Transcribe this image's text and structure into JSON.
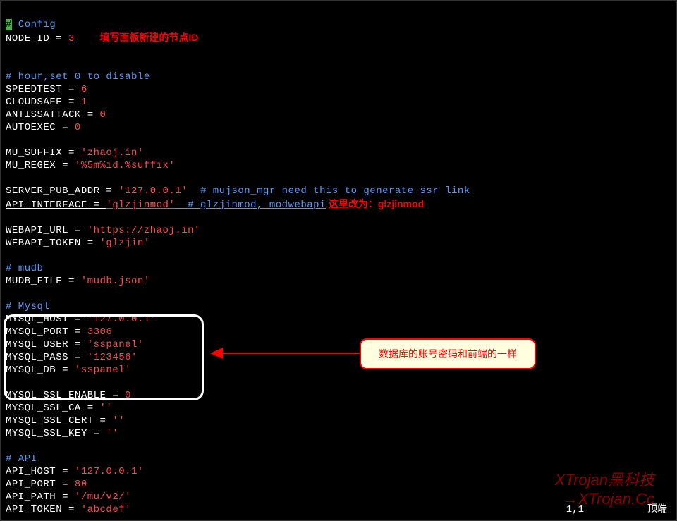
{
  "title_hash": "#",
  "title_word": " Config",
  "node_id_key": "NODE_ID = ",
  "node_id_val": "3",
  "annot_node": "填写面板新建的节点ID",
  "comment_hour": "# hour,set 0 to disable",
  "speedtest_k": "SPEEDTEST = ",
  "speedtest_v": "6",
  "cloudsafe_k": "CLOUDSAFE = ",
  "cloudsafe_v": "1",
  "antiss_k": "ANTISSATTACK = ",
  "antiss_v": "0",
  "autoexec_k": "AUTOEXEC = ",
  "autoexec_v": "0",
  "musuffix_k": "MU_SUFFIX = ",
  "musuffix_v": "'zhaoj.in'",
  "muregex_k": "MU_REGEX = ",
  "muregex_v": "'%5m%id.%suffix'",
  "serverpub_k": "SERVER_PUB_ADDR = ",
  "serverpub_v": "'127.0.0.1'",
  "serverpub_c": "  # mujson_mgr need this to generate ssr link",
  "apiint_k": "API_INTERFACE = ",
  "apiint_v": "'glzjinmod'",
  "apiint_c": "  # glzjinmod, modwebapi",
  "annot_api_prefix": " 这里改为：",
  "annot_api_bold": "glzjinmod",
  "webapiurl_k": "WEBAPI_URL = ",
  "webapiurl_v": "'https://zhaoj.in'",
  "webapitoken_k": "WEBAPI_TOKEN = ",
  "webapitoken_v": "'glzjin'",
  "comment_mudb": "# mudb",
  "mudbfile_k": "MUDB_FILE = ",
  "mudbfile_v": "'mudb.json'",
  "comment_mysql": "# Mysql",
  "mysqlhost_k": "MYSQL_HOST = ",
  "mysqlhost_v": "'127.0.0.1'",
  "mysqlport_k": "MYSQL_PORT = ",
  "mysqlport_v": "3306",
  "mysqluser_k": "MYSQL_USER = ",
  "mysqluser_v": "'sspanel'",
  "mysqlpass_k": "MYSQL_PASS = ",
  "mysqlpass_v": "'123456'",
  "mysqldb_k": "MYSQL_DB = ",
  "mysqldb_v": "'sspanel'",
  "mysqlsslen_k": "MYSQL_SSL_ENABLE = ",
  "mysqlsslen_v": "0",
  "mysqlsslca_k": "MYSQL_SSL_CA = ",
  "mysqlsslca_v": "''",
  "mysqlsslcert_k": "MYSQL_SSL_CERT = ",
  "mysqlsslcert_v": "''",
  "mysqlsslkey_k": "MYSQL_SSL_KEY = ",
  "mysqlsslkey_v": "''",
  "comment_api": "# API",
  "apihost_k": "API_HOST = ",
  "apihost_v": "'127.0.0.1'",
  "apiport_k": "API_PORT = ",
  "apiport_v": "80",
  "apipath_k": "API_PATH = ",
  "apipath_v": "'/mu/v2/'",
  "apitoken_k": "API_TOKEN = ",
  "apitoken_v": "'abcdef'",
  "callout_text": "数据库的账号密码和前端的一样",
  "status_pos": "1,1",
  "status_right": "顶端",
  "watermark1": "XTrojan黑科技",
  "watermark2_arrow": "→",
  "watermark2_text": "XTrojan.Cc"
}
